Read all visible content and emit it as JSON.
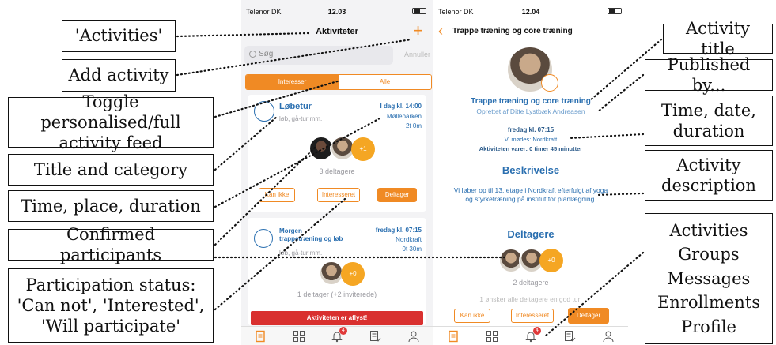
{
  "annotations": {
    "activities": "'Activities'",
    "add_activity": "Add activity",
    "toggle_line1": "Toggle personalised/full",
    "toggle_line2": "activity feed",
    "title_category": "Title and category",
    "time_place": "Time, place, duration",
    "confirmed": "Confirmed participants",
    "status_line1": "Participation status:",
    "status_line2": "'Can not', 'Interested',",
    "status_line3": "'Will participate'",
    "activity_title": "Activity title",
    "published_by": "Published by...",
    "time_date_line1": "Time, date,",
    "time_date_line2": "duration",
    "description_line1": "Activity",
    "description_line2": "description",
    "nav_line1": "Activities",
    "nav_line2": "Groups",
    "nav_line3": "Messages",
    "nav_line4": "Enrollments",
    "nav_line5": "Profile"
  },
  "left_phone": {
    "carrier": "Telenor DK",
    "time": "12.03",
    "title": "Aktiviteter",
    "add_symbol": "+",
    "search_placeholder": "Søg",
    "cancel": "Annuller",
    "toggle_interests": "Interesser",
    "toggle_all": "Alle",
    "card1": {
      "title": "Løbetur",
      "category": "løb, gå-tur mm.",
      "when": "I dag kl. 14:00",
      "place": "Mølleparken",
      "duration": "2t 0m",
      "more": "+1",
      "participants": "3 deltagere",
      "btn_cannot": "Kan ikke",
      "btn_interested": "Interesseret",
      "btn_participate": "Deltager"
    },
    "card2": {
      "title_line1": "Morgen",
      "title_line2": "trappetræning og løb",
      "category": "løb, gå-tur mm.",
      "when": "fredag kl. 07:15",
      "place": "Nordkraft",
      "duration": "0t 30m",
      "more": "+0",
      "participants": "1 deltager (+2 inviterede)",
      "cancelled": "Aktiviteten er aflyst!"
    },
    "tab_badge": "4"
  },
  "right_phone": {
    "carrier": "Telenor DK",
    "time": "12.04",
    "title": "Trappe træning og core træning",
    "activity_title": "Trappe træning og core træning",
    "created_by": "Oprettet af Ditte Lystbæk Andreasen",
    "when": "fredag kl. 07:15",
    "meet": "Vi mødes: Nordkraft",
    "duration": "Aktiviteten varer: 0 timer 45 minutter",
    "description_heading": "Beskrivelse",
    "description": "Vi løber op til 13. etage i Nordkraft efterfulgt af yoga og styrketræning på institut for planlægning.",
    "participants_heading": "Deltagere",
    "more": "+0",
    "participants_count": "2 deltagere",
    "wish": "1 ønsker alle deltagere en god tur!",
    "btn_cannot": "Kan ikke",
    "btn_interested": "Interesseret",
    "btn_participate": "Deltager",
    "tab_badge": "4"
  },
  "colors": {
    "accent": "#f08a24",
    "link_blue": "#2a6fb0",
    "danger": "#d9302f"
  }
}
